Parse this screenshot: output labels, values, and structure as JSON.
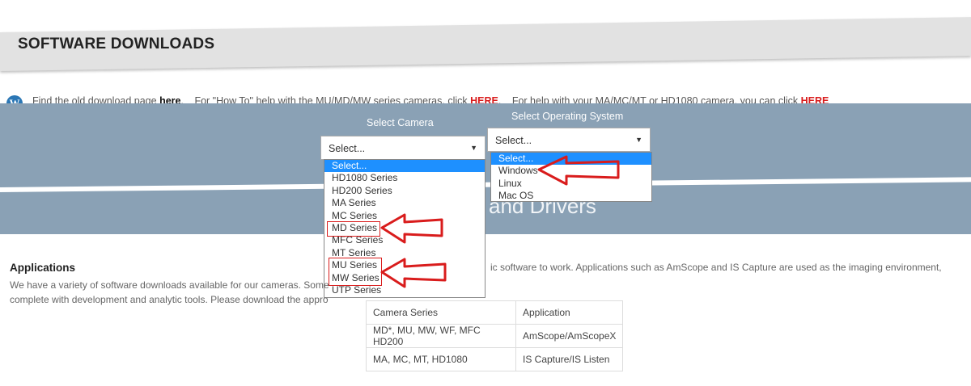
{
  "header": {
    "title": "SOFTWARE DOWNLOADS"
  },
  "info": {
    "t1": "Find the old download page ",
    "here1": "here",
    "t2": ".",
    "t3": "For \"How To\" help with the MU/MD/MW series cameras, click ",
    "here2": "HERE",
    "t4": ".",
    "t5": "For help with your MA/MC/MT or HD1080 camera, you can click ",
    "here3": "HERE"
  },
  "camera_select": {
    "label": "Select Camera",
    "value": "Select...",
    "options": [
      "Select...",
      "HD1080 Series",
      "HD200 Series",
      "MA Series",
      "MC Series",
      "MD Series",
      "MFC Series",
      "MT Series",
      "MU Series",
      "MW Series",
      "UTP Series"
    ]
  },
  "os_select": {
    "label": "Select Operating System",
    "value": "Select...",
    "options": [
      "Select...",
      "Windows",
      "Linux",
      "Mac OS"
    ]
  },
  "band": {
    "heading": "and Drivers"
  },
  "applications": {
    "title": "Applications",
    "line1a": "We have a variety of software downloads available for our cameras. Some",
    "line1b": "ic software to work. Applications such as AmScope and IS Capture are used as the imaging environment,",
    "line2": "complete with development and analytic tools. Please download the appro"
  },
  "table": {
    "headers": [
      "Camera Series",
      "Application"
    ],
    "rows": [
      [
        "MD*, MU, MW, WF, MFC HD200",
        "AmScope/AmScopeX"
      ],
      [
        "MA, MC, MT, HD1080",
        "IS Capture/IS Listen"
      ]
    ]
  },
  "colors": {
    "band": "#8aa1b5",
    "link_red": "#d91c1c",
    "selected": "#1e90ff",
    "annotation": "#d91c1c"
  }
}
